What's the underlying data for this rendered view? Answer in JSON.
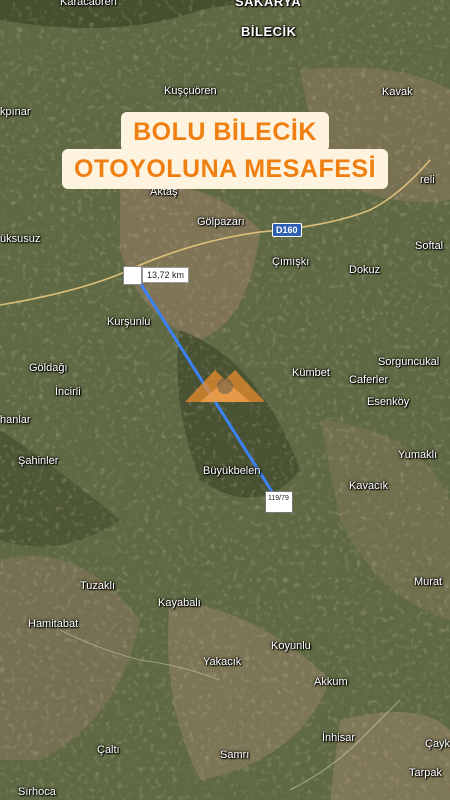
{
  "headline": {
    "line1": "BOLU BİLECİK",
    "line2": "OTOYOLUNA MESAFESİ"
  },
  "measure": {
    "distance": "13,72 km",
    "parcel": "119/79",
    "line_color": "#3b82f6"
  },
  "road": {
    "code": "D160"
  },
  "colors": {
    "headline_bg": "#fdf3de",
    "headline_text": "#f07f11",
    "road_shield": "#2f5fb3"
  },
  "icons": [
    "logo-icon"
  ],
  "places": [
    {
      "id": "karacaoren",
      "name": "Karacaören"
    },
    {
      "id": "sakarya",
      "name": "SAKARYA"
    },
    {
      "id": "bilecik",
      "name": "BİLECİK"
    },
    {
      "id": "kuscuoren",
      "name": "Kuşçuören"
    },
    {
      "id": "kavak",
      "name": "Kavak"
    },
    {
      "id": "akpinar",
      "name": "kpınar"
    },
    {
      "id": "aktas",
      "name": "Aktaş"
    },
    {
      "id": "gureli",
      "name": "reli"
    },
    {
      "id": "golpazari",
      "name": "Gölpazarı"
    },
    {
      "id": "buksusuz",
      "name": "üksusuz"
    },
    {
      "id": "softa",
      "name": "Softal"
    },
    {
      "id": "cimiski",
      "name": "Çımışkı"
    },
    {
      "id": "dokuz",
      "name": "Dokuz"
    },
    {
      "id": "kursunlu",
      "name": "Kurşunlu"
    },
    {
      "id": "sorguncukal",
      "name": "Sorguncukal"
    },
    {
      "id": "goldagi",
      "name": "Göldağı"
    },
    {
      "id": "kumbet",
      "name": "Kümbet"
    },
    {
      "id": "caferler",
      "name": "Caferler"
    },
    {
      "id": "incirli",
      "name": "İncirli"
    },
    {
      "id": "esenkoy",
      "name": "Esenköy"
    },
    {
      "id": "hanlar",
      "name": "hanlar"
    },
    {
      "id": "yumakli",
      "name": "Yumaklı"
    },
    {
      "id": "sahinler",
      "name": "Şahinler"
    },
    {
      "id": "buyukbelen",
      "name": "Büyükbelen"
    },
    {
      "id": "kavacik",
      "name": "Kavacık"
    },
    {
      "id": "tuzakli",
      "name": "Tuzaklı"
    },
    {
      "id": "murat",
      "name": "Murat"
    },
    {
      "id": "kayabali",
      "name": "Kayabalı"
    },
    {
      "id": "hamitabat",
      "name": "Hamitabat"
    },
    {
      "id": "koyunlu",
      "name": "Koyunlu"
    },
    {
      "id": "yakacik",
      "name": "Yakacık"
    },
    {
      "id": "akkum",
      "name": "Akkum"
    },
    {
      "id": "inhisar",
      "name": "İnhisar"
    },
    {
      "id": "caltı",
      "name": "Çaltı"
    },
    {
      "id": "samri",
      "name": "Samrı"
    },
    {
      "id": "cayk",
      "name": "Çayk"
    },
    {
      "id": "sirhoca",
      "name": "Sırhoca"
    },
    {
      "id": "tarpak",
      "name": "Tarpak"
    }
  ]
}
